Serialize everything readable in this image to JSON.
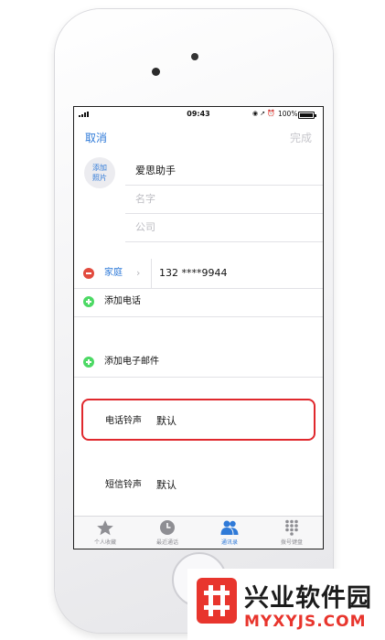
{
  "status_bar": {
    "time": "09:43",
    "battery": "100%",
    "battery_level": 1.0
  },
  "nav": {
    "cancel": "取消",
    "done": "完成"
  },
  "add_photo": {
    "line1": "添加",
    "line2": "照片"
  },
  "fields": {
    "surname": "爱思助手",
    "first_name_placeholder": "名字",
    "company_placeholder": "公司"
  },
  "phone_entry": {
    "label": "家庭",
    "number": "132 ****9944"
  },
  "add_phone": "添加电话",
  "add_email": "添加电子邮件",
  "ringtone": {
    "title": "电话铃声",
    "value": "默认"
  },
  "text_tone": {
    "title": "短信铃声",
    "value": "默认"
  },
  "tabs": [
    {
      "label": "个人收藏",
      "icon": "star-icon"
    },
    {
      "label": "最近通话",
      "icon": "clock-icon"
    },
    {
      "label": "通讯录",
      "icon": "contacts-icon",
      "active": true
    },
    {
      "label": "拨号键盘",
      "icon": "keypad-icon"
    }
  ],
  "watermark": {
    "title": "兴业软件园",
    "url": "MYXYJS.COM"
  },
  "colors": {
    "accent": "#2f7ad8",
    "highlight": "#e0282d",
    "delete": "#e24b3e",
    "add": "#4cd964",
    "brand": "#e8352d"
  }
}
